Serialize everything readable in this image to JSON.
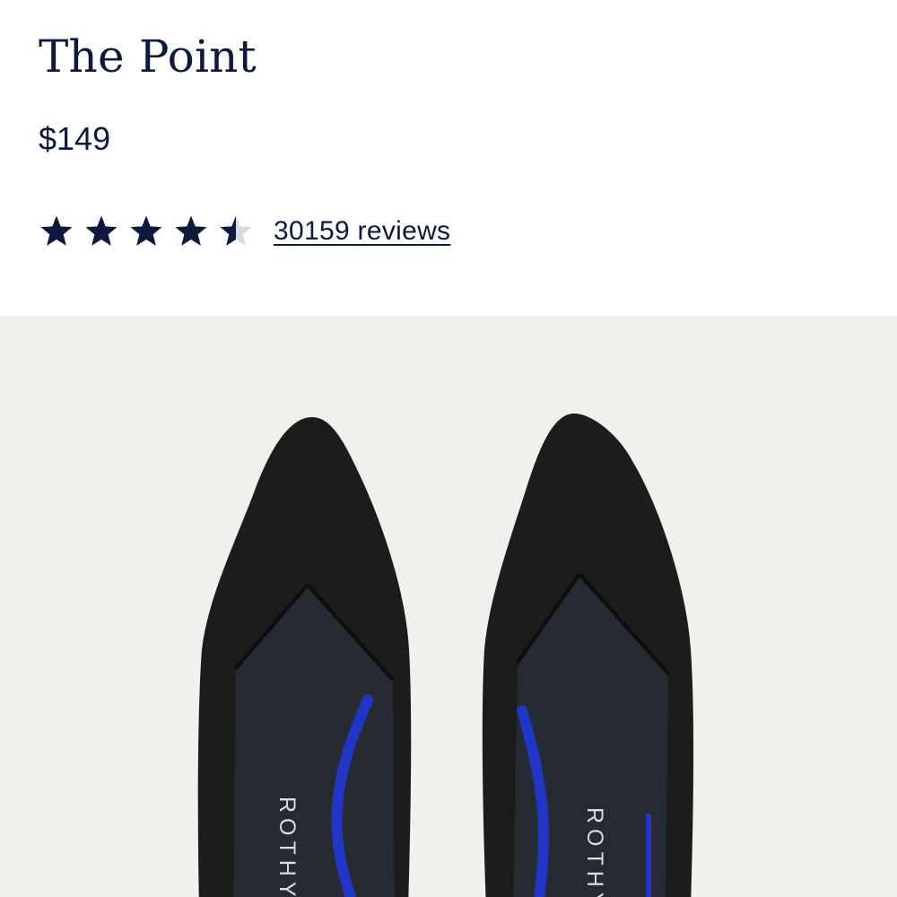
{
  "product": {
    "title": "The Point",
    "price": "$149"
  },
  "rating": {
    "value": 4.5,
    "max": 5,
    "reviews_label": "30159 reviews"
  },
  "image": {
    "brand_mark": "ROTHY"
  },
  "colors": {
    "text_navy": "#0c1a3e",
    "star_filled": "#0c1a3e",
    "star_empty": "#d9d9e0",
    "image_background": "#f1f0ec",
    "shoe_knit": "#1c1c1c",
    "insole": "#262a33",
    "accent_blue": "#1f37c4"
  }
}
